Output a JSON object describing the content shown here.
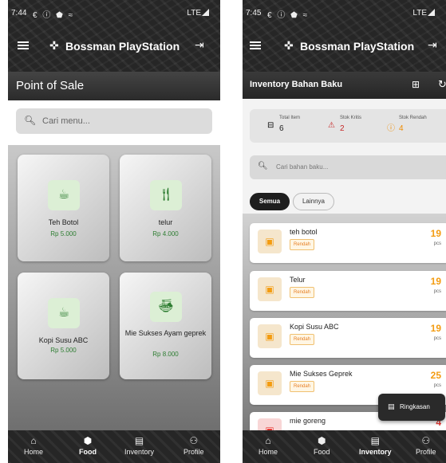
{
  "left": {
    "status": {
      "time": "7:44",
      "icons": "€ ⓘ ⬟ ≈",
      "network": "LTE"
    },
    "appbar": {
      "title": "Bossman PlayStation"
    },
    "section_title": "Point of Sale",
    "search": {
      "placeholder": "Cari menu..."
    },
    "menu_items": [
      {
        "name": "Teh Botol",
        "price": "Rp 5.000",
        "icon": "coffee-maker-icon"
      },
      {
        "name": "telur",
        "price": "Rp 4.000",
        "icon": "restaurant-icon"
      },
      {
        "name": "Kopi Susu ABC",
        "price": "Rp 5.000",
        "icon": "coffee-cup-icon"
      },
      {
        "name": "Mie Sukses Ayam geprek",
        "price": "Rp 8.000",
        "icon": "ramen-bowl-icon"
      }
    ],
    "nav": [
      {
        "label": "Home",
        "icon": "home-icon",
        "active": false
      },
      {
        "label": "Food",
        "icon": "food-icon",
        "active": true
      },
      {
        "label": "Inventory",
        "icon": "inventory-icon",
        "active": false
      },
      {
        "label": "Profile",
        "icon": "person-icon",
        "active": false
      }
    ]
  },
  "right": {
    "status": {
      "time": "7:45",
      "icons": "€ ⓘ ⬟ ≈",
      "network": "LTE"
    },
    "appbar": {
      "title": "Bossman PlayStation"
    },
    "section_title": "Inventory Bahan Baku",
    "stats": [
      {
        "label": "Total Item",
        "value": "6",
        "icon": "box-icon",
        "color": "#222222"
      },
      {
        "label": "Stok Kritis",
        "value": "2",
        "icon": "warning-icon",
        "color": "#c62828"
      },
      {
        "label": "Stok Rendah",
        "value": "4",
        "icon": "info-icon",
        "color": "#ef8c00"
      }
    ],
    "search": {
      "placeholder": "Cari bahan baku..."
    },
    "filters": [
      {
        "label": "Semua",
        "selected": true
      },
      {
        "label": "Lainnya",
        "selected": false
      }
    ],
    "items": [
      {
        "name": "teh botol",
        "badge": "Rendah",
        "qty": "19",
        "unit": "pcs"
      },
      {
        "name": "Telur",
        "badge": "Rendah",
        "qty": "19",
        "unit": "pcs"
      },
      {
        "name": "Kopi Susu ABC",
        "badge": "Rendah",
        "qty": "19",
        "unit": "pcs"
      },
      {
        "name": "Mie Sukses Geprek",
        "badge": "Rendah",
        "qty": "25",
        "unit": "pcs"
      },
      {
        "name": "mie goreng",
        "badge": "",
        "qty": "4",
        "unit": ""
      }
    ],
    "fab": {
      "label": "Ringkasan"
    },
    "nav": [
      {
        "label": "Home",
        "icon": "home-icon",
        "active": false
      },
      {
        "label": "Food",
        "icon": "food-icon",
        "active": false
      },
      {
        "label": "Inventory",
        "icon": "inventory-icon",
        "active": true
      },
      {
        "label": "Profile",
        "icon": "person-icon",
        "active": false
      }
    ]
  }
}
